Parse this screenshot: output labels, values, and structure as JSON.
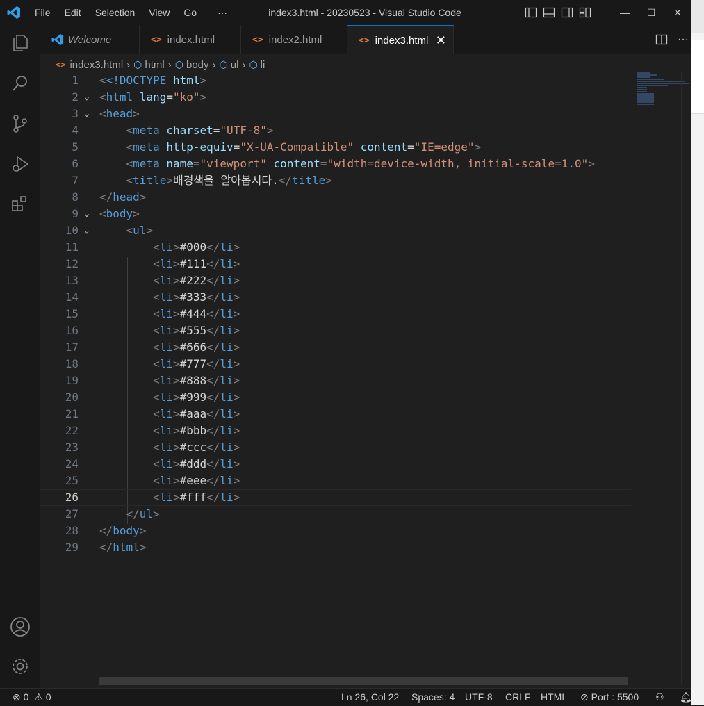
{
  "titlebar": {
    "menu": [
      "File",
      "Edit",
      "Selection",
      "View",
      "Go",
      "···"
    ],
    "title": "index3.html - 20230523 - Visual Studio Code",
    "minimize": "—",
    "maximize": "☐",
    "close": "✕"
  },
  "tabs": [
    {
      "label": "Welcome",
      "active": false
    },
    {
      "label": "index.html",
      "active": false
    },
    {
      "label": "index2.html",
      "active": false
    },
    {
      "label": "index3.html",
      "active": true
    }
  ],
  "tab_close": "✕",
  "tab_more": "···",
  "breadcrumb": [
    "index3.html",
    "html",
    "body",
    "ul",
    "li"
  ],
  "editor": {
    "current_line": 26,
    "lines": [
      {
        "n": "1"
      },
      {
        "n": "2"
      },
      {
        "n": "3"
      },
      {
        "n": "4"
      },
      {
        "n": "5"
      },
      {
        "n": "6"
      },
      {
        "n": "7"
      },
      {
        "n": "8"
      },
      {
        "n": "9"
      },
      {
        "n": "10"
      },
      {
        "n": "11"
      },
      {
        "n": "12"
      },
      {
        "n": "13"
      },
      {
        "n": "14"
      },
      {
        "n": "15"
      },
      {
        "n": "16"
      },
      {
        "n": "17"
      },
      {
        "n": "18"
      },
      {
        "n": "19"
      },
      {
        "n": "20"
      },
      {
        "n": "21"
      },
      {
        "n": "22"
      },
      {
        "n": "23"
      },
      {
        "n": "24"
      },
      {
        "n": "25"
      },
      {
        "n": "26"
      },
      {
        "n": "27"
      },
      {
        "n": "28"
      },
      {
        "n": "29"
      }
    ],
    "code": {
      "doctype_open": "<!DOCTYPE",
      "doctype_name": " html",
      "doctype_close": ">",
      "html_lang_attr": "lang",
      "html_lang_val": "\"ko\"",
      "meta_charset_attr": "charset",
      "meta_charset_val": "\"UTF-8\"",
      "meta_http_attr": "http-equiv",
      "meta_http_val": "\"X-UA-Compatible\"",
      "meta_content_attr": "content",
      "meta_content_val": "\"IE=edge\"",
      "meta_name_attr": "name",
      "meta_name_val": "\"viewport\"",
      "meta_vp_content_val": "\"width=device-width, initial-scale=1.0\"",
      "title_text": "배경색을 알아봅시다.",
      "li_values": [
        "#000",
        "#111",
        "#222",
        "#333",
        "#444",
        "#555",
        "#666",
        "#777",
        "#888",
        "#999",
        "#aaa",
        "#bbb",
        "#ccc",
        "#ddd",
        "#eee",
        "#fff"
      ]
    }
  },
  "statusbar": {
    "errors": "0",
    "warnings": "0",
    "position": "Ln 26, Col 22",
    "spaces": "Spaces: 4",
    "encoding": "UTF-8",
    "eol": "CRLF",
    "language": "HTML",
    "port": "Port : 5500"
  },
  "colors": {
    "accent": "#0078d4",
    "tag": "#569cd6",
    "attribute": "#9cdcfe",
    "string": "#ce9178",
    "html_file_icon": "#e37933"
  }
}
